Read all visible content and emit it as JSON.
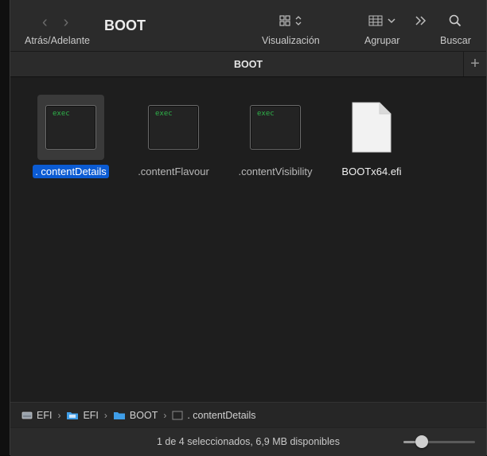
{
  "window": {
    "title": "BOOT",
    "path_title": "BOOT"
  },
  "toolbar": {
    "nav_label": "Atrás/Adelante",
    "view_label": "Visualización",
    "group_label": "Agrupar",
    "search_label": "Buscar"
  },
  "files": [
    {
      "name": ". contentDetails",
      "icon": "terminal-exec-icon",
      "badge": "exec",
      "selected": true
    },
    {
      "name": ".contentFlavour",
      "icon": "terminal-exec-icon",
      "badge": "exec",
      "selected": false
    },
    {
      "name": ".contentVisibility",
      "icon": "terminal-exec-icon",
      "badge": "exec",
      "selected": false
    },
    {
      "name": "BOOTx64.efi",
      "icon": "document-icon",
      "selected": false
    }
  ],
  "pathbar": {
    "items": [
      {
        "label": "EFI",
        "icon": "disk-icon"
      },
      {
        "label": "EFI",
        "icon": "folder-icon"
      },
      {
        "label": "BOOT",
        "icon": "folder-icon"
      },
      {
        "label": ". contentDetails",
        "icon": "terminal-file-icon"
      }
    ]
  },
  "status": {
    "text": "1 de 4 seleccionados, 6,9 MB disponibles",
    "zoom_level": 0.25
  },
  "colors": {
    "selection": "#0b5bd3",
    "exec_text": "#2fb34a",
    "window_bg": "#1e1e1e",
    "toolbar_bg": "#2b2b2b"
  }
}
